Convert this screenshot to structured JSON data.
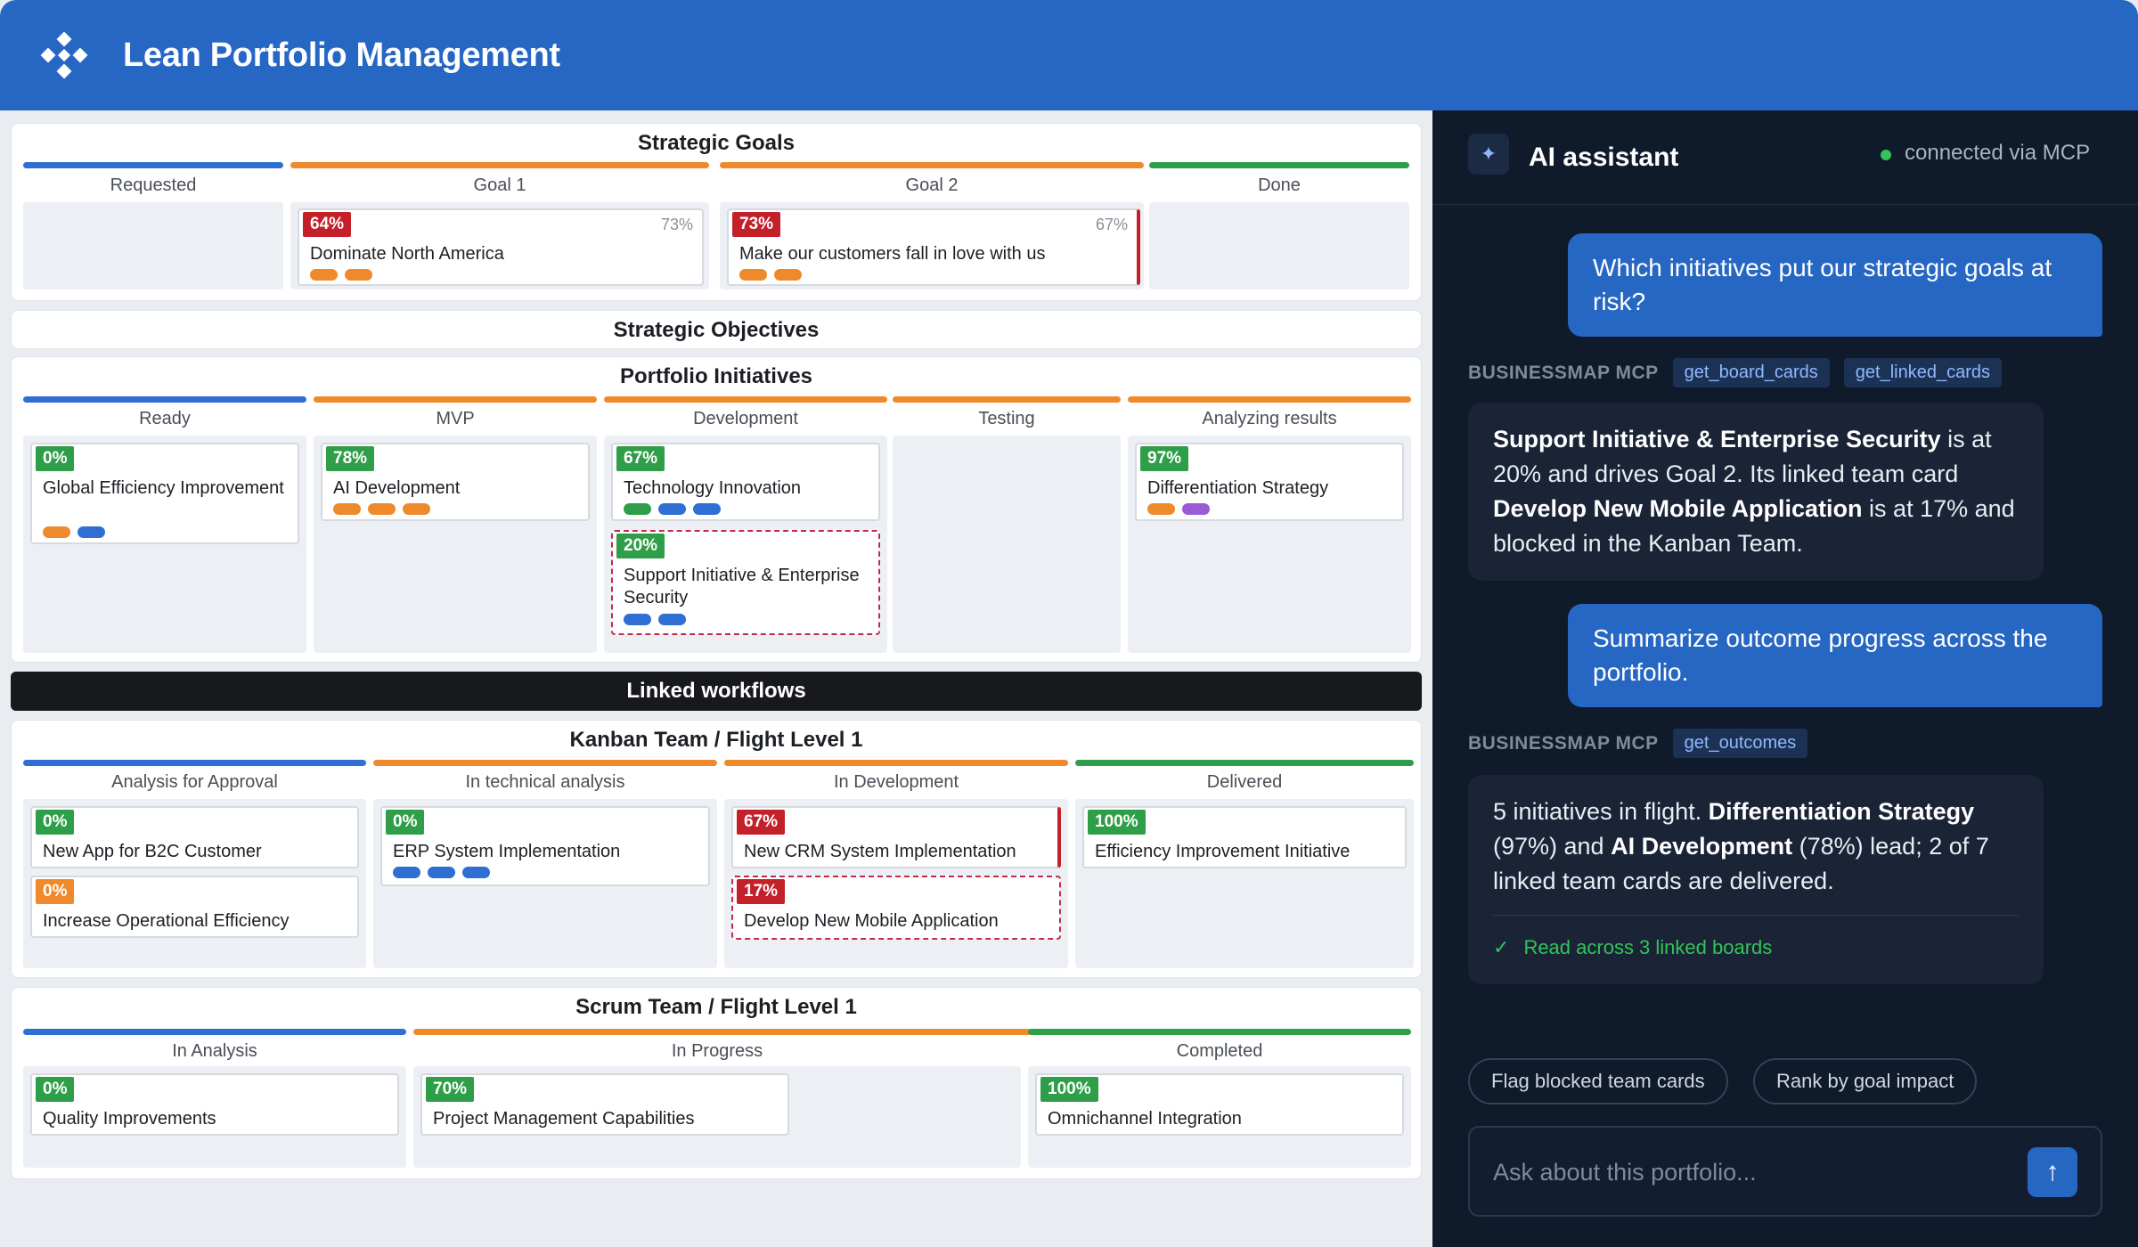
{
  "app": {
    "title": "Lean Portfolio Management"
  },
  "strategic_goals": {
    "title": "Strategic Goals",
    "columns": [
      "Requested",
      "Goal 1",
      "Goal 2",
      "Done"
    ],
    "cards": [
      {
        "badge": "64%",
        "secondary": "73%",
        "title": "Dominate North America"
      },
      {
        "badge": "73%",
        "secondary": "67%",
        "title": "Make our customers fall in love with us"
      }
    ]
  },
  "strategic_objectives": {
    "title": "Strategic Objectives"
  },
  "portfolio_initiatives": {
    "title": "Portfolio Initiatives",
    "columns": [
      "Ready",
      "MVP",
      "Development",
      "Testing",
      "Analyzing results"
    ],
    "cards": [
      {
        "badge": "0%",
        "title": "Global Efficiency Improvement"
      },
      {
        "badge": "78%",
        "title": "AI Development"
      },
      {
        "badge": "67%",
        "title": "Technology Innovation"
      },
      {
        "badge": "20%",
        "title": "Support Initiative & Enterprise Security"
      },
      {
        "badge": "97%",
        "title": "Differentiation Strategy"
      }
    ]
  },
  "linked_workflows": {
    "title": "Linked workflows"
  },
  "kanban": {
    "title": "Kanban Team / Flight Level 1",
    "columns": [
      "Analysis for Approval",
      "In technical analysis",
      "In Development",
      "Delivered"
    ],
    "cards": [
      {
        "badge": "0%",
        "title": "New App for B2C Customer"
      },
      {
        "badge": "0%",
        "title": "Increase Operational Efficiency"
      },
      {
        "badge": "0%",
        "title": "ERP System Implementation"
      },
      {
        "badge": "67%",
        "title": "New CRM System Implementation"
      },
      {
        "badge": "17%",
        "title": "Develop New Mobile Application"
      },
      {
        "badge": "100%",
        "title": "Efficiency Improvement Initiative"
      }
    ]
  },
  "scrum": {
    "title": "Scrum Team / Flight Level 1",
    "columns": [
      "In Analysis",
      "In Progress",
      "Completed"
    ],
    "cards": [
      {
        "badge": "0%",
        "title": "Quality Improvements"
      },
      {
        "badge": "70%",
        "title": "Project Management Capabilities"
      },
      {
        "badge": "100%",
        "title": "Omnichannel Integration"
      }
    ]
  },
  "assistant": {
    "title": "AI assistant",
    "status": "connected via MCP",
    "messages": [
      {
        "role": "user",
        "text": "Which initiatives put our strategic goals at risk?"
      },
      {
        "role": "tool",
        "label": "BUSINESSMAP MCP",
        "tools": [
          "get_board_cards",
          "get_linked_cards"
        ]
      },
      {
        "role": "assistant",
        "b1": "Support Initiative & Enterprise Security",
        "t1": " is at 20% and drives Goal 2. Its linked team card ",
        "b2": "Develop New Mobile Application",
        "t2": " is at 17% and blocked in the Kanban Team."
      },
      {
        "role": "user",
        "text": "Summarize outcome progress across the portfolio."
      },
      {
        "role": "tool",
        "label": "BUSINESSMAP MCP",
        "tools": [
          "get_outcomes"
        ]
      },
      {
        "role": "assistant",
        "t0": "5 initiatives in flight. ",
        "b1": "Differentiation Strategy",
        "t1": " (97%) and ",
        "b2": "AI Development",
        "t2": " (78%) lead; 2 of 7 linked team cards are delivered.",
        "footer": "Read across 3 linked boards"
      }
    ],
    "suggestions": [
      "Flag blocked team cards",
      "Rank by goal impact"
    ],
    "input_placeholder": "Ask about this portfolio..."
  },
  "colors": {
    "header": "#2767c4",
    "panel_dark": "#0f1a2a",
    "bar_blue": "#2f6fd3",
    "bar_orange": "#ee8a2c",
    "bar_green": "#2f9e48",
    "danger": "#c4202a"
  },
  "icons": {
    "logo": "diamond-grid-logo-icon",
    "assistant": "sparkle-icon",
    "done": "checkmark-icon",
    "send": "arrow-up-icon"
  }
}
